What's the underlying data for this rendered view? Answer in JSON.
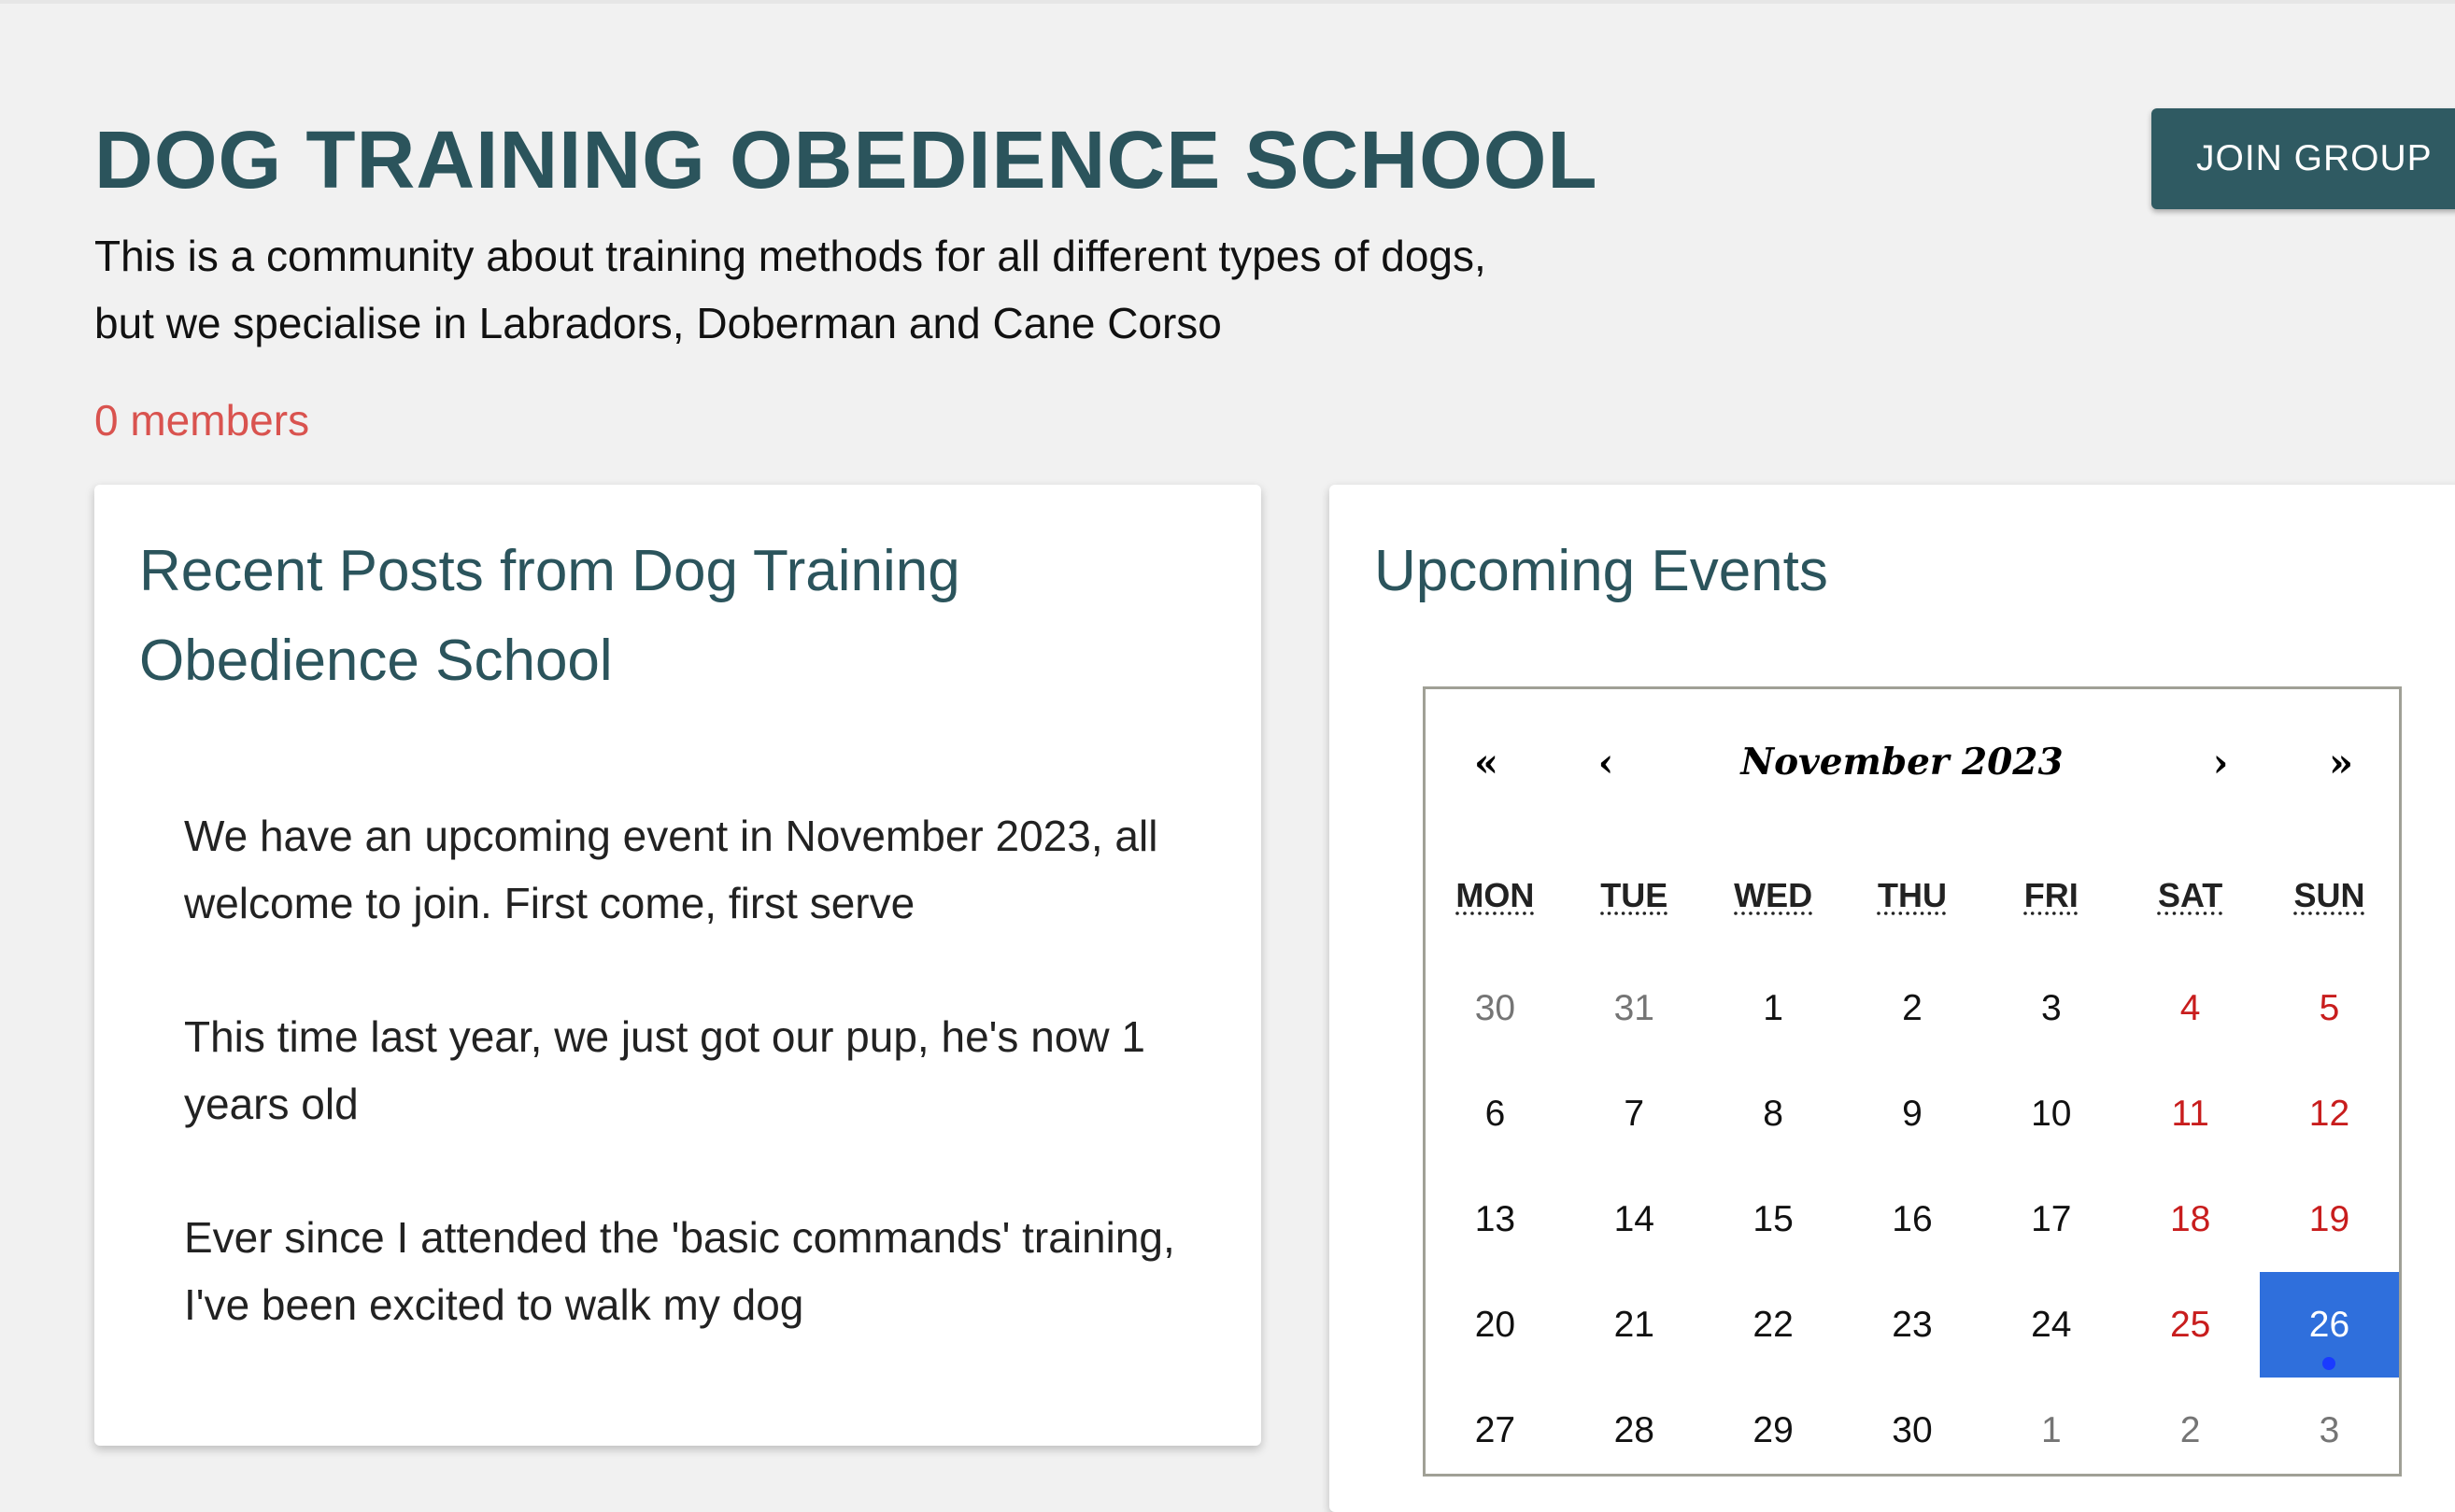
{
  "header": {
    "title": "DOG TRAINING OBEDIENCE SCHOOL",
    "description": "This is a community about training methods for all different types of dogs, but we specialise in Labradors, Doberman and Cane Corso",
    "members": "0 members",
    "join_label": "JOIN GROUP"
  },
  "posts": {
    "title": "Recent Posts from Dog Training Obedience School",
    "items": [
      "We have an upcoming event in November 2023, all welcome to join. First come, first serve",
      "This time last year, we just got our pup, he's now 1 years old",
      "Ever since I attended the 'basic commands' training, I've been excited to walk my dog"
    ]
  },
  "events": {
    "title": "Upcoming Events",
    "calendar": {
      "month_label": "November 2023",
      "nav": {
        "prev_year": "«",
        "prev_month": "‹",
        "next_month": "›",
        "next_year": "»"
      },
      "weekdays": [
        "MON",
        "TUE",
        "WED",
        "THU",
        "FRI",
        "SAT",
        "SUN"
      ],
      "days": [
        "30",
        "31",
        "1",
        "2",
        "3",
        "4",
        "5",
        "6",
        "7",
        "8",
        "9",
        "10",
        "11",
        "12",
        "13",
        "14",
        "15",
        "16",
        "17",
        "18",
        "19",
        "20",
        "21",
        "22",
        "23",
        "24",
        "25",
        "26",
        "27",
        "28",
        "29",
        "30",
        "1",
        "2",
        "3"
      ],
      "selected_day": "26",
      "event_day": "26",
      "colors": {
        "weekend": "#c81d1d",
        "selected": "#2f6fdc",
        "event_dot": "#1a3bff",
        "other_month": "#757575"
      }
    }
  },
  "colors": {
    "title": "#2b545c",
    "button": "#2f5a62",
    "members": "#d9534f",
    "background": "#f1f1f1"
  }
}
